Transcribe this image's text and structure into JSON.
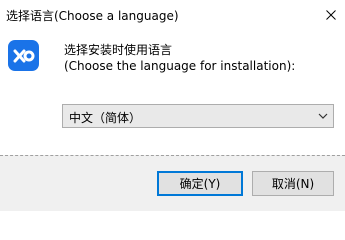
{
  "window": {
    "title": "选择语言(Choose a language)"
  },
  "icons": {
    "app": "app-logo-icon",
    "close": "close-icon",
    "dropdown": "chevron-down-icon"
  },
  "prompt": {
    "line1": "选择安装时使用语言",
    "line2": "(Choose the language for installation):"
  },
  "language_select": {
    "selected": "中文（简体）"
  },
  "buttons": {
    "ok_label": "确定(Y)",
    "cancel_label": "取消(N)"
  },
  "colors": {
    "accent": "#0078d7",
    "app_icon": "#1a73e8"
  }
}
